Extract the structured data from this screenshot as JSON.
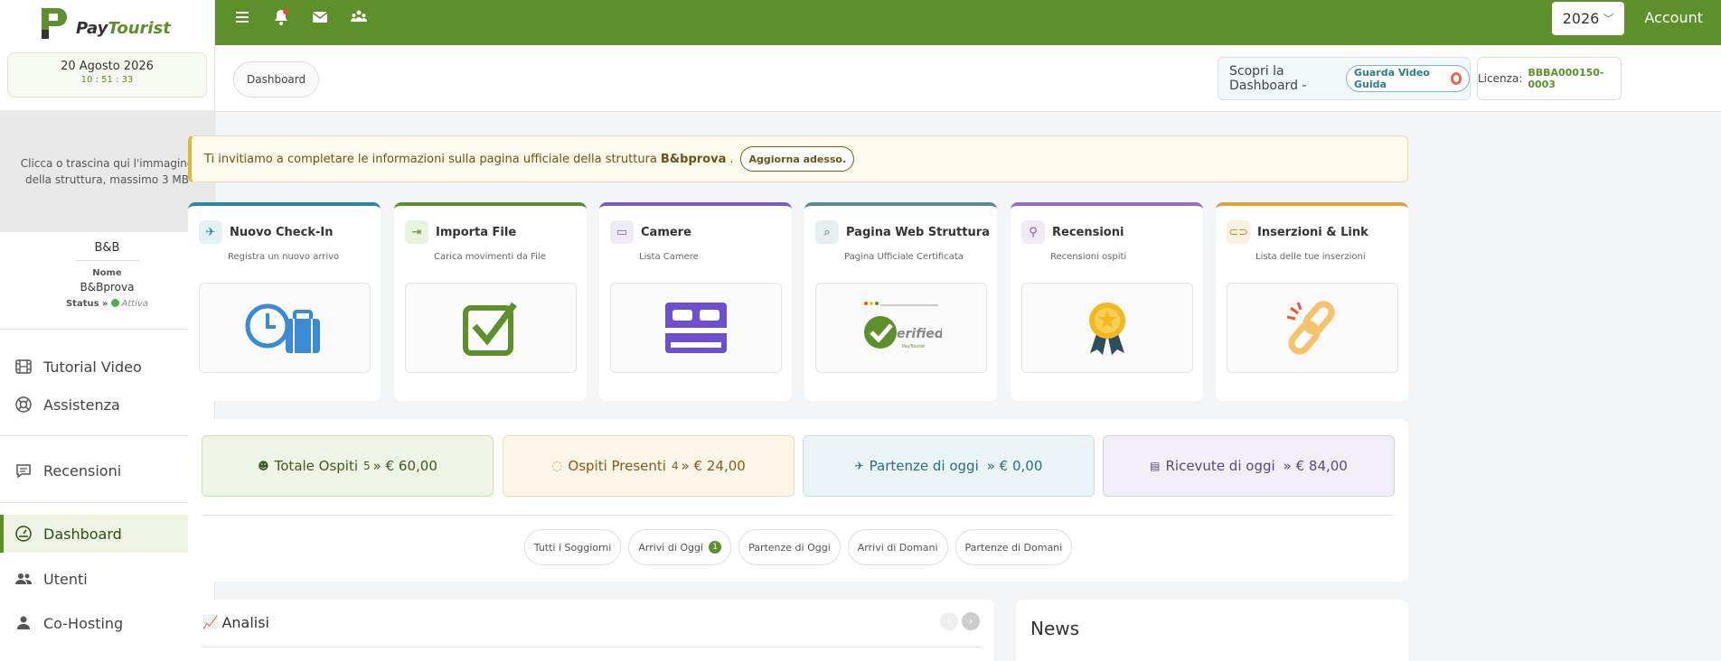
{
  "brand": {
    "name_part1": "Pay",
    "name_part2": "Tourist",
    "color": "#5d8f2b"
  },
  "clock": {
    "date": "20 Agosto 2026",
    "time": "10 : 51 : 33"
  },
  "upload_hint": "Clicca o trascina qui l'immagine della struttura, massimo 3 MB",
  "property": {
    "type": "B&B",
    "name_label": "Nome",
    "name": "B&Bprova",
    "status_label": "Status »",
    "status": "Attiva"
  },
  "sidebar": {
    "items": [
      {
        "label": "Tutorial Video",
        "icon": "film-icon"
      },
      {
        "label": "Assistenza",
        "icon": "lifebuoy-icon"
      },
      {
        "label": "Recensioni",
        "icon": "comment-icon"
      },
      {
        "label": "Dashboard",
        "icon": "dashboard-icon"
      },
      {
        "label": "Utenti",
        "icon": "users-icon"
      },
      {
        "label": "Co-Hosting",
        "icon": "person-icon"
      }
    ]
  },
  "topbar": {
    "year": "2026",
    "account": "Account"
  },
  "breadcrumb": "Dashboard",
  "discover": {
    "label": "Scopri la Dashboard -",
    "button": "Guarda Video Guida"
  },
  "license": {
    "label": "Licenza:",
    "value": "BBBA000150-0003"
  },
  "alert": {
    "text": "Ti invitiamo a completare le informazioni sulla pagina ufficiale della struttura",
    "property": "B&bprova",
    "suffix": ".",
    "button": "Aggiorna adesso."
  },
  "cards": [
    {
      "title": "Nuovo Check-In",
      "subtitle": "Registra un nuovo arrivo",
      "color": "#2b8aa3"
    },
    {
      "title": "Importa File",
      "subtitle": "Carica movimenti da File",
      "color": "#5d8f2b"
    },
    {
      "title": "Camere",
      "subtitle": "Lista Camere",
      "color": "#7a5cc7"
    },
    {
      "title": "Pagina Web Struttura",
      "subtitle": "Pagina Ufficiale Certificata",
      "color": "#5a8a8f"
    },
    {
      "title": "Recensioni",
      "subtitle": "Recensioni ospiti",
      "color": "#9a6bc2"
    },
    {
      "title": "Inserzioni & Link",
      "subtitle": "Lista delle tue inserzioni",
      "color": "#e0a13a"
    }
  ],
  "verified_text": "erified",
  "verified_sub": "PayTourist",
  "stats": [
    {
      "label": "Totale Ospiti",
      "count": "5",
      "amount": "» € 60,00"
    },
    {
      "label": "Ospiti Presenti",
      "count": "4",
      "amount": "» € 24,00"
    },
    {
      "label": "Partenze di oggi",
      "count": "",
      "amount": "» € 0,00"
    },
    {
      "label": "Ricevute di oggi",
      "count": "",
      "amount": "» € 84,00"
    }
  ],
  "filters": {
    "all": "Tutti i Soggiorni",
    "arrivals_today": "Arrivi di Oggi",
    "arrivals_today_badge": "1",
    "departures_today": "Partenze di Oggi",
    "arrivals_tomorrow": "Arrivi di Domani",
    "departures_tomorrow": "Partenze di Domani"
  },
  "analysis": {
    "title": "Analisi"
  },
  "news": {
    "title": "News"
  }
}
